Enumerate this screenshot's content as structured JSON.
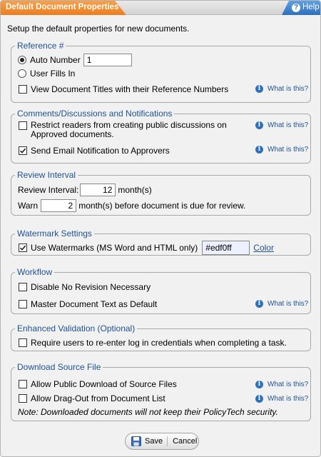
{
  "dialog": {
    "title": "Default Document Properties",
    "help_label": "Help",
    "intro": "Setup the default properties for new documents."
  },
  "what_is_this": "What is this?",
  "reference": {
    "title": "Reference #",
    "auto_number_label": "Auto Number",
    "auto_number_value": "1",
    "user_fills_in_label": "User Fills In",
    "view_titles_label": "View Document Titles with their Reference Numbers"
  },
  "comments": {
    "title": "Comments/Discussions and Notifications",
    "restrict_label_line1": "Restrict readers from creating public discussions on",
    "restrict_label_line2": "Approved documents.",
    "send_email_label": "Send Email Notification to Approvers"
  },
  "review": {
    "title": "Review Interval",
    "interval_label": "Review Interval:",
    "interval_value": "12",
    "interval_unit": "month(s)",
    "warn_label": "Warn",
    "warn_value": "2",
    "warn_suffix": "month(s) before document is due for review."
  },
  "watermark": {
    "title": "Watermark Settings",
    "use_label": "Use Watermarks (MS Word and HTML only)",
    "color_value": "#edf0ff",
    "color_link": "Color"
  },
  "workflow": {
    "title": "Workflow",
    "disable_label": "Disable No Revision Necessary",
    "master_label": "Master Document Text as Default"
  },
  "validation": {
    "title": "Enhanced Validation (Optional)",
    "require_label": "Require users to re-enter log in credentials when completing a task."
  },
  "download": {
    "title": "Download Source File",
    "public_label": "Allow Public Download of Source Files",
    "dragout_label": "Allow Drag-Out from Document List",
    "note": "Note: Downloaded documents will not keep their PolicyTech security."
  },
  "buttons": {
    "save": "Save",
    "cancel": "Cancel"
  }
}
